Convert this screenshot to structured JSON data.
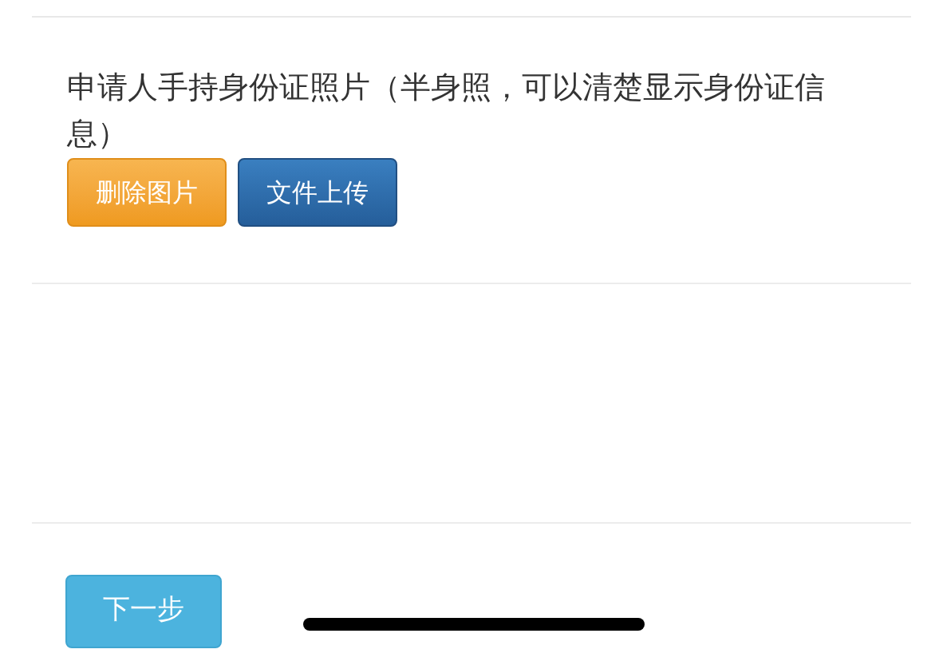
{
  "upload_section": {
    "label": "申请人手持身份证照片（半身照，可以清楚显示身份证信息）",
    "buttons": [
      {
        "kind": "delete",
        "label": "删除图片"
      },
      {
        "kind": "upload",
        "label": "文件上传"
      }
    ]
  },
  "next_button": {
    "label": "下一步"
  }
}
